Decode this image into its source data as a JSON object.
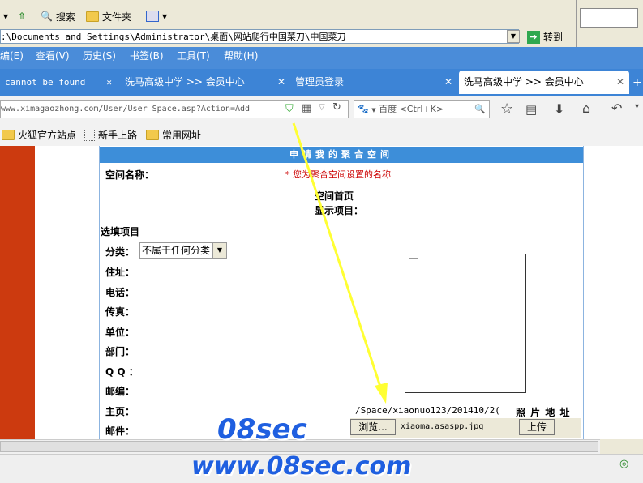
{
  "explorer": {
    "search_label": "搜索",
    "folders_label": "文件夹",
    "address_value": ":\\Documents and Settings\\Administrator\\桌面\\网站爬行中国菜刀\\中国菜刀",
    "go_label": "转到"
  },
  "firefox": {
    "menu": [
      "编(E)",
      "查看(V)",
      "历史(S)",
      "书签(B)",
      "工具(T)",
      "帮助(H)"
    ],
    "tabs": [
      {
        "label": "cannot be found"
      },
      {
        "label": "洗马高级中学 >> 会员中心"
      },
      {
        "label": "管理员登录"
      },
      {
        "label": "洗马高级中学 >> 会员中心"
      }
    ],
    "url": "www.ximagaozhong.com/User/User_Space.asp?Action=Add",
    "search_engine": "百度",
    "search_placeholder": "<Ctrl+K>",
    "bookmarks": [
      "火狐官方站点",
      "新手上路",
      "常用网址"
    ]
  },
  "form": {
    "header": "申请我的聚合空间",
    "space_name_label": "空间名称：",
    "space_name_hint": "* 您为聚合空间设置的名称",
    "homepage_label": "空间首页",
    "display_label": "显示项目：",
    "optional_label": "选填项目",
    "category_label": "分类：",
    "category_value": "不属于任何分类",
    "fields": [
      "住址：",
      "电话：",
      "传真：",
      "单位：",
      "部门：",
      "Q Q ：",
      "邮编：",
      "主页：",
      "邮件："
    ],
    "photo_path": "/Space/xiaonuo123/201410/2(",
    "photo_label": "照 片 地 址",
    "browse_label": "浏览...",
    "file_name": "xiaoma.asaspp.jpg",
    "upload_label": "上传"
  },
  "watermark": {
    "line1": "08sec",
    "line2": "www.08sec.com"
  },
  "colors": {
    "firefox_blue": "#3d84d6",
    "panel_head": "#3d8ed9",
    "sidebar_red": "#cc3a0f",
    "hint_red": "#cc0000",
    "arrow_yellow": "#ffff33"
  }
}
